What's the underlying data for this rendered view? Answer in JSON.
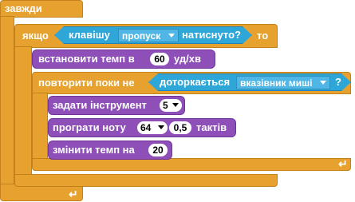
{
  "forever": {
    "label": "завжди"
  },
  "if_block": {
    "label_if": "якщо",
    "label_then": "то"
  },
  "key_sensor": {
    "label_key": "клавішу",
    "key_value": "пропуск",
    "label_pressed": "натиснуто?"
  },
  "set_tempo": {
    "label": "встановити темп в",
    "value": "60",
    "unit": "уд/хв"
  },
  "repeat_until": {
    "label": "повторити поки не"
  },
  "touching_sensor": {
    "label": "доторкається",
    "target": "вказівник миші"
  },
  "set_instrument": {
    "label": "задати інструмент",
    "value": "5"
  },
  "play_note": {
    "label": "програти ноту",
    "note": "64",
    "beats": "0,5",
    "unit": "тактів"
  },
  "change_tempo": {
    "label": "змінити темп на",
    "value": "20"
  },
  "icons": {
    "loop_arrow": "loop-arrow-icon",
    "dropdown": "chevron-down-icon"
  },
  "colors": {
    "control": "#e6a12f",
    "sensing": "#2fa6d8",
    "sound": "#8e4fb9"
  }
}
